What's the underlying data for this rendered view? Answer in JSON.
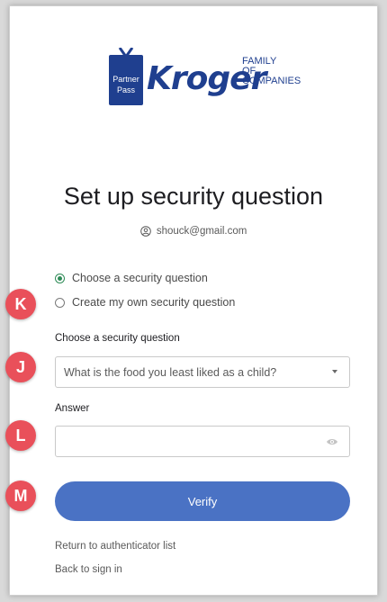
{
  "logo": {
    "partner_top": "Partner",
    "partner_bottom": "Pass",
    "brand": "Kroger",
    "family_line1": "FAMILY",
    "family_line2": "OF",
    "family_line3": "COMPANIES",
    "brand_color": "#1f3f8f"
  },
  "header": {
    "title": "Set up security question",
    "user_icon": "user-circle-icon",
    "email": "shouck@gmail.com"
  },
  "options": {
    "choose_label": "Choose a security question",
    "create_label": "Create my own security question",
    "selected": "choose"
  },
  "question_field": {
    "label": "Choose a security question",
    "value": "What is the food you least liked as a child?"
  },
  "answer_field": {
    "label": "Answer",
    "value": ""
  },
  "verify_button": {
    "label": "Verify",
    "color": "#4a72c4"
  },
  "links": {
    "return": "Return to authenticator list",
    "back": "Back to sign in"
  },
  "markers": {
    "k": "K",
    "j": "J",
    "l": "L",
    "m": "M",
    "color": "#e9505a"
  }
}
